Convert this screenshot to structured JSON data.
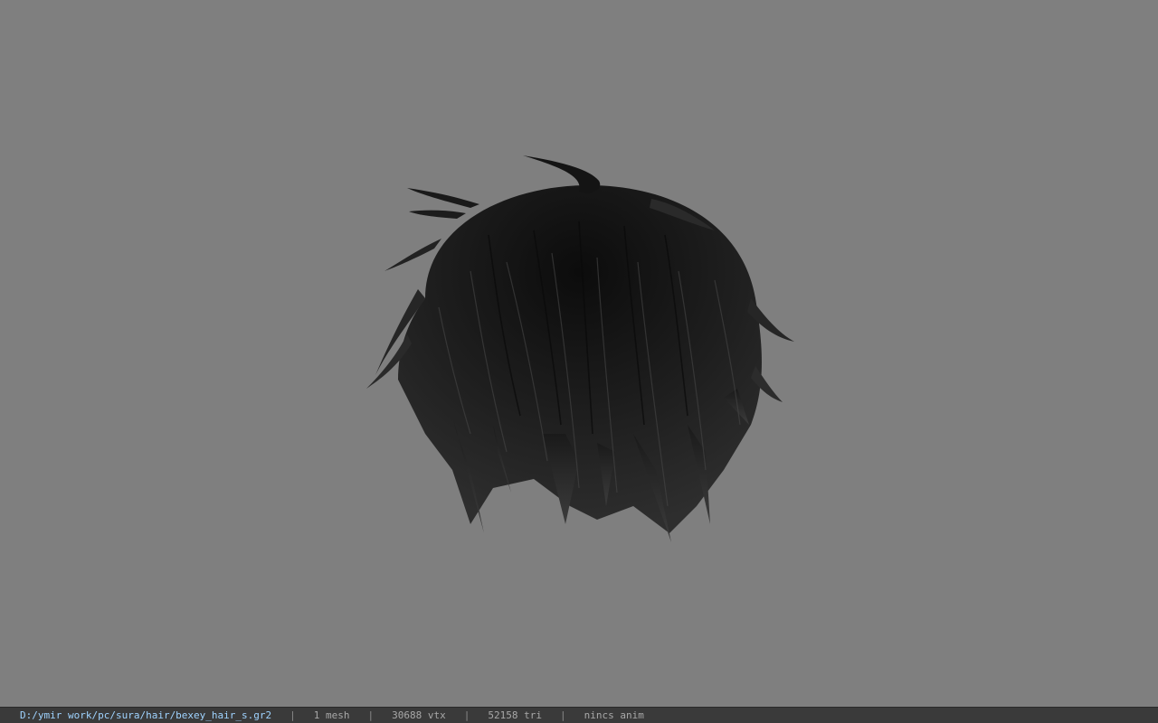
{
  "viewport": {
    "background": "#7f7f7f",
    "model": "hair-mesh"
  },
  "status": {
    "path": "D:/ymir work/pc/sura/hair/bexey_hair_s.gr2",
    "separator": "|",
    "mesh_count": "1 mesh",
    "vertex_count": "30688 vtx",
    "triangle_count": "52158 tri",
    "anim": "nincs anim"
  },
  "colors": {
    "statusbar_bg": "#3a3a3a",
    "path_text": "#9fd3ff",
    "status_text": "#a8a8a8",
    "hair_dark": "#121212",
    "hair_mid": "#2c2c2c",
    "hair_highlight": "#4a4a4a"
  }
}
